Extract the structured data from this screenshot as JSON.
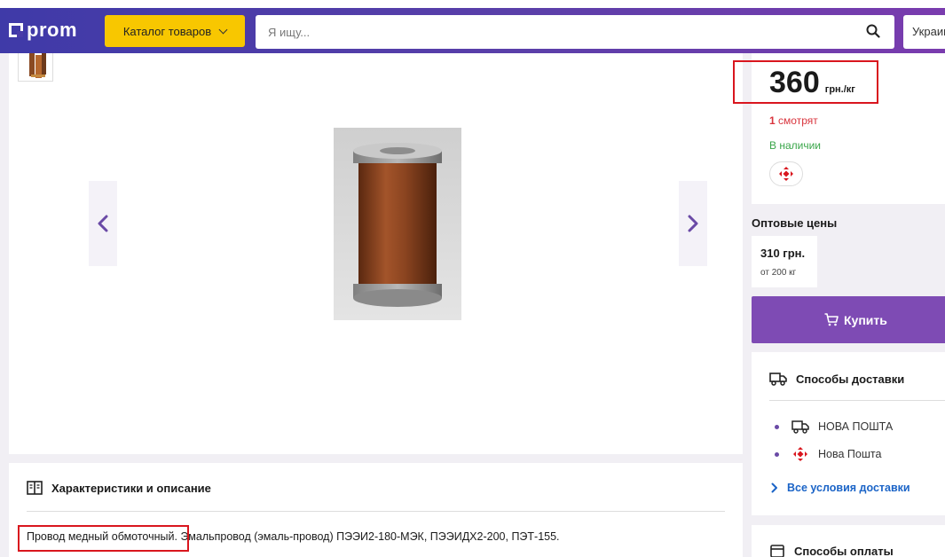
{
  "header": {
    "logo_text": "prom",
    "catalog_label": "Каталог товаров",
    "search_placeholder": "Я ищу...",
    "region_label": "Украина"
  },
  "gallery": {
    "thumbnail_alt": "Провод медный обмоточный",
    "photo_alt": "Провод медный обмоточный"
  },
  "product": {
    "price_value": "360",
    "price_unit": "грн./кг",
    "watching_count": "1",
    "watching_label": "смотрят",
    "stock_status": "В наличии"
  },
  "wholesale": {
    "title": "Оптовые цены",
    "tiers": [
      {
        "price": "310 грн.",
        "min_qty": "от 200 кг"
      }
    ]
  },
  "buy": {
    "label": "Купить"
  },
  "delivery": {
    "title": "Способы доставки",
    "items": [
      {
        "label": "НОВА ПОШТА",
        "icon": "truck-icon"
      },
      {
        "label": "Нова Пошта",
        "icon": "nova-poshta-icon"
      }
    ],
    "more_label": "Все условия доставки"
  },
  "payment": {
    "title": "Способы оплаты"
  },
  "characteristics": {
    "title": "Характеристики и описание",
    "description_highlight": "Провод медный обмоточный.",
    "description_rest": " Эмальпровод (эмаль-провод) ПЭЭИ2-180-МЭК, ПЭЭИДХ2-200, ПЭТ-155."
  },
  "colors": {
    "header_start": "#3f3aa8",
    "header_end": "#7a3cae",
    "catalog_button": "#f8c700",
    "buy_button": "#7e4bb4",
    "highlight_border": "#d9161e",
    "watching_text": "#d9343d",
    "stock_text": "#3aa64a",
    "link": "#1b64c7"
  }
}
